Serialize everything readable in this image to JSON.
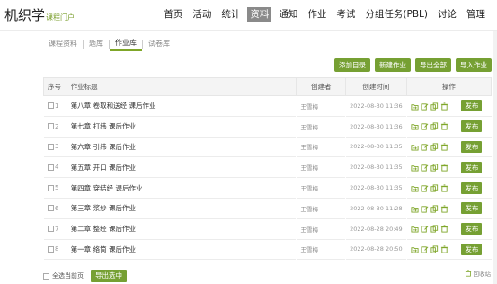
{
  "brand": {
    "title": "机织学",
    "subtitle": "课程门户"
  },
  "nav": [
    "首页",
    "活动",
    "统计",
    "资料",
    "通知",
    "作业",
    "考试",
    "分组任务(PBL)",
    "讨论",
    "管理"
  ],
  "nav_active_index": 3,
  "subtabs": [
    "课程资料",
    "题库",
    "作业库",
    "试卷库"
  ],
  "subtab_active_index": 2,
  "actions": {
    "add_dir": "添加目录",
    "new_work": "新建作业",
    "export_all": "导出全部",
    "import_work": "导入作业"
  },
  "table": {
    "headers": {
      "seq": "序号",
      "title": "作业标题",
      "creator": "创建者",
      "time": "创建时间",
      "ops": "操作"
    },
    "rows": [
      {
        "seq": "1",
        "title": "第八章 卷取和送经 课后作业",
        "creator": "王雪梅",
        "time": "2022-08-30 11:36",
        "publish": "发布"
      },
      {
        "seq": "2",
        "title": "第七章 打纬 课后作业",
        "creator": "王雪梅",
        "time": "2022-08-30 11:36",
        "publish": "发布"
      },
      {
        "seq": "3",
        "title": "第六章 引纬 课后作业",
        "creator": "王雪梅",
        "time": "2022-08-30 11:35",
        "publish": "发布"
      },
      {
        "seq": "4",
        "title": "第五章 开口 课后作业",
        "creator": "王雪梅",
        "time": "2022-08-30 11:35",
        "publish": "发布"
      },
      {
        "seq": "5",
        "title": "第四章 穿结经 课后作业",
        "creator": "王雪梅",
        "time": "2022-08-30 11:35",
        "publish": "发布"
      },
      {
        "seq": "6",
        "title": "第三章 浆纱 课后作业",
        "creator": "王雪梅",
        "time": "2022-08-30 11:28",
        "publish": "发布"
      },
      {
        "seq": "7",
        "title": "第二章 整经 课后作业",
        "creator": "王雪梅",
        "time": "2022-08-28 20:49",
        "publish": "发布"
      },
      {
        "seq": "8",
        "title": "第一章 络筒 课后作业",
        "creator": "王雪梅",
        "time": "2022-08-28 20:50",
        "publish": "发布"
      }
    ]
  },
  "footer": {
    "select_page": "全选当前页",
    "export_selected": "导出选中",
    "recycle": "回收站"
  },
  "colors": {
    "accent": "#76a033",
    "nav_active": "#8a8a8a"
  }
}
